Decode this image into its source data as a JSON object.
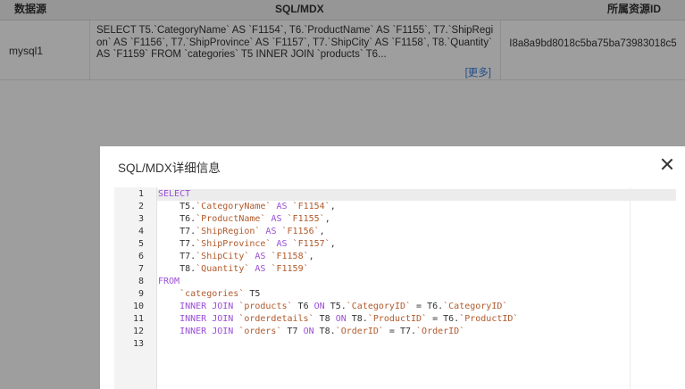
{
  "table": {
    "headers": [
      "数据源",
      "SQL/MDX",
      "所属资源ID"
    ],
    "row": {
      "source": "mysql1",
      "sql_preview": "SELECT T5.`CategoryName` AS `F1154`, T6.`ProductName` AS `F1155`, T7.`ShipRegion` AS `F1156`, T7.`ShipProvince` AS `F1157`, T7.`ShipCity` AS `F1158`, T8.`Quantity` AS `F1159` FROM `categories` T5 INNER JOIN `products` T6...",
      "more_label": "[更多]",
      "resource_id": "I8a8a9bd8018c5ba75ba73983018c5"
    }
  },
  "dialog": {
    "title": "SQL/MDX详细信息",
    "close_icon": "close-icon",
    "line_numbers": [
      "1",
      "2",
      "3",
      "4",
      "5",
      "6",
      "7",
      "8",
      "9",
      "10",
      "11",
      "12",
      "13"
    ],
    "code_lines": [
      [
        {
          "t": "SELECT",
          "c": "kw"
        }
      ],
      [
        {
          "t": "    T5.",
          "c": ""
        },
        {
          "t": "`CategoryName`",
          "c": "fld"
        },
        {
          "t": " AS ",
          "c": "kw"
        },
        {
          "t": "`F1154`",
          "c": "fld"
        },
        {
          "t": ",",
          "c": ""
        }
      ],
      [
        {
          "t": "    T6.",
          "c": ""
        },
        {
          "t": "`ProductName`",
          "c": "fld"
        },
        {
          "t": " AS ",
          "c": "kw"
        },
        {
          "t": "`F1155`",
          "c": "fld"
        },
        {
          "t": ",",
          "c": ""
        }
      ],
      [
        {
          "t": "    T7.",
          "c": ""
        },
        {
          "t": "`ShipRegion`",
          "c": "fld"
        },
        {
          "t": " AS ",
          "c": "kw"
        },
        {
          "t": "`F1156`",
          "c": "fld"
        },
        {
          "t": ",",
          "c": ""
        }
      ],
      [
        {
          "t": "    T7.",
          "c": ""
        },
        {
          "t": "`ShipProvince`",
          "c": "fld"
        },
        {
          "t": " AS ",
          "c": "kw"
        },
        {
          "t": "`F1157`",
          "c": "fld"
        },
        {
          "t": ",",
          "c": ""
        }
      ],
      [
        {
          "t": "    T7.",
          "c": ""
        },
        {
          "t": "`ShipCity`",
          "c": "fld"
        },
        {
          "t": " AS ",
          "c": "kw"
        },
        {
          "t": "`F1158`",
          "c": "fld"
        },
        {
          "t": ",",
          "c": ""
        }
      ],
      [
        {
          "t": "    T8.",
          "c": ""
        },
        {
          "t": "`Quantity`",
          "c": "fld"
        },
        {
          "t": " AS ",
          "c": "kw"
        },
        {
          "t": "`F1159`",
          "c": "fld"
        }
      ],
      [
        {
          "t": "FROM",
          "c": "kw"
        }
      ],
      [
        {
          "t": "    ",
          "c": ""
        },
        {
          "t": "`categories`",
          "c": "fld"
        },
        {
          "t": " T5",
          "c": ""
        }
      ],
      [
        {
          "t": "    INNER JOIN ",
          "c": "kw"
        },
        {
          "t": "`products`",
          "c": "fld"
        },
        {
          "t": " T6 ",
          "c": ""
        },
        {
          "t": "ON",
          "c": "kw"
        },
        {
          "t": " T5.",
          "c": ""
        },
        {
          "t": "`CategoryID`",
          "c": "fld"
        },
        {
          "t": " = T6.",
          "c": ""
        },
        {
          "t": "`CategoryID`",
          "c": "fld"
        }
      ],
      [
        {
          "t": "    INNER JOIN ",
          "c": "kw"
        },
        {
          "t": "`orderdetails`",
          "c": "fld"
        },
        {
          "t": " T8 ",
          "c": ""
        },
        {
          "t": "ON",
          "c": "kw"
        },
        {
          "t": " T8.",
          "c": ""
        },
        {
          "t": "`ProductID`",
          "c": "fld"
        },
        {
          "t": " = T6.",
          "c": ""
        },
        {
          "t": "`ProductID`",
          "c": "fld"
        }
      ],
      [
        {
          "t": "    INNER JOIN ",
          "c": "kw"
        },
        {
          "t": "`orders`",
          "c": "fld"
        },
        {
          "t": " T7 ",
          "c": ""
        },
        {
          "t": "ON",
          "c": "kw"
        },
        {
          "t": " T8.",
          "c": ""
        },
        {
          "t": "`OrderID`",
          "c": "fld"
        },
        {
          "t": " = T7.",
          "c": ""
        },
        {
          "t": "`OrderID`",
          "c": "fld"
        }
      ],
      []
    ]
  },
  "colors": {
    "keyword": "#9a4fd6",
    "identifier": "#b15a2c",
    "link": "#3b7ddd"
  }
}
